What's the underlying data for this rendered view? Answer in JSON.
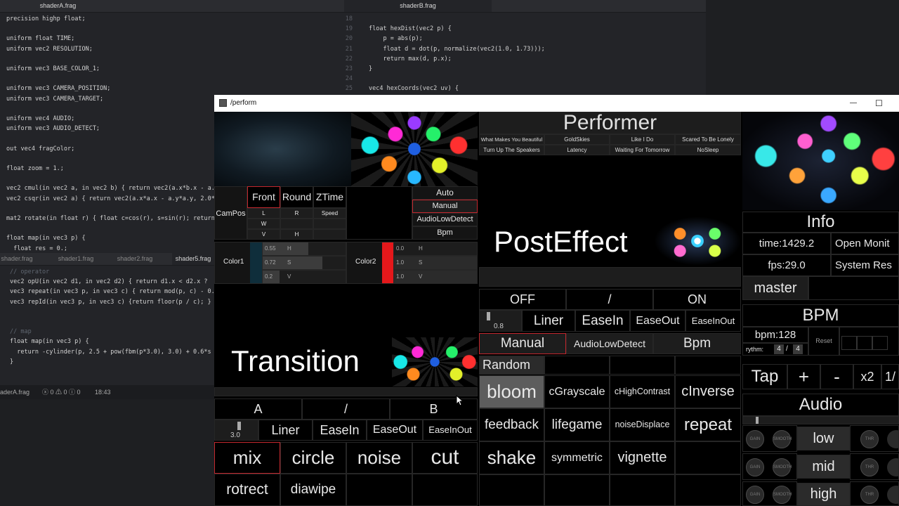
{
  "editor": {
    "tab_a": "shaderA.frag",
    "tab_b": "shaderB.frag",
    "bottom_tabs": [
      "shader.frag",
      "shader1.frag",
      "shader2.frag",
      "shader5.frag"
    ],
    "code_a": [
      "precision highp float;",
      "",
      "uniform float TIME;",
      "uniform vec2 RESOLUTION;",
      "",
      "uniform vec3 BASE_COLOR_1;",
      "",
      "uniform vec3 CAMERA_POSITION;",
      "uniform vec3 CAMERA_TARGET;",
      "",
      "uniform vec4 AUDIO;",
      "uniform vec3 AUDIO_DETECT;",
      "",
      "out vec4 fragColor;",
      "",
      "float zoom = 1.;",
      "",
      "vec2 cmul(in vec2 a, in vec2 b) { return vec2(a.x*b.x - a.",
      "vec2 csqr(in vec2 a) { return vec2(a.x*a.x - a.y*a.y, 2.0*",
      "",
      "mat2 rotate(in float r) { float c=cos(r), s=sin(r); return",
      "",
      "float map(in vec3 p) {",
      "  float res = 0.;"
    ],
    "code_b_numbers": [
      "18",
      "19",
      "20",
      "21",
      "22",
      "23",
      "24",
      "25"
    ],
    "code_b": [
      "",
      "float hexDist(vec2 p) {",
      "    p = abs(p);",
      "    float d = dot(p, normalize(vec2(1.0, 1.73)));",
      "    return max(d, p.x);",
      "}",
      "",
      "vec4 hexCoords(vec2 uv) {"
    ],
    "code_c": [
      "// operator",
      "vec2 opU(in vec2 d1, in vec2 d2) { return d1.x < d2.x ?",
      "vec3 repeat(in vec3 p, in vec3 c) { return mod(p, c) - 0.",
      "vec3 repId(in vec3 p, in vec3 c) {return floor(p / c); }",
      "",
      "",
      "// map",
      "float map(in vec3 p) {",
      "  return -cylinder(p, 2.5 + pow(fbm(p*3.0), 3.0) + 0.6*s",
      "}"
    ],
    "status_file": "aderA.frag",
    "status_problems": "ⓧ 0 ⚠ 0 ⓘ 0",
    "status_pos": "18:43"
  },
  "window": {
    "title": "/perform",
    "minimize": "—",
    "maximize": "☐"
  },
  "camera": {
    "campos": "CamPos",
    "tabs": [
      "Front",
      "Round",
      "ZTime"
    ],
    "rows": [
      [
        "L",
        "R",
        "Speed"
      ],
      [
        "W",
        "",
        ""
      ],
      [
        "V",
        "H",
        ""
      ]
    ],
    "modes": [
      "Auto",
      "Manual",
      "AudioLowDetect",
      "Bpm"
    ],
    "color1_label": "Color1",
    "color1_values": [
      "0.55",
      "0.72",
      "0.2"
    ],
    "color1_keys": [
      "H",
      "S",
      "V"
    ],
    "color2_label": "Color2",
    "color2_values": [
      "0.0",
      "1.0",
      "1.0"
    ],
    "color2_keys": [
      "H",
      "S",
      "V"
    ]
  },
  "transition": {
    "title": "Transition",
    "a": "A",
    "slash": "/",
    "b": "B",
    "value": "3.0",
    "easings": [
      "Liner",
      "EaseIn",
      "EaseOut",
      "EaseInOut"
    ],
    "effects": [
      "mix",
      "circle",
      "noise",
      "cut",
      "rotrect",
      "diawipe"
    ]
  },
  "performer": {
    "title": "Performer",
    "songs": [
      "What Makes You Beautiful",
      "GoldSkies",
      "Like I Do",
      "Scared To Be Lonely",
      "Turn Up The Speakers",
      "Latency",
      "Waiting For Tomorrow",
      "NoSleep"
    ]
  },
  "posteffect": {
    "title": "PostEffect",
    "off": "OFF",
    "slash": "/",
    "on": "ON",
    "value": "0.8",
    "easings": [
      "Liner",
      "EaseIn",
      "EaseOut",
      "EaseInOut"
    ],
    "modes": [
      "Manual",
      "AudioLowDetect",
      "Bpm"
    ],
    "random": "Random",
    "effects": [
      "bloom",
      "cGrayscale",
      "cHighContrast",
      "cInverse",
      "feedback",
      "lifegame",
      "noiseDisplace",
      "repeat",
      "shake",
      "symmetric",
      "vignette"
    ]
  },
  "info": {
    "title": "Info",
    "time": "time:1429.2",
    "fps": "fps:29.0",
    "open_monitor": "Open Monit",
    "system_res": "System Res",
    "master": "master"
  },
  "bpm": {
    "title": "BPM",
    "value": "bpm:128",
    "rhythm_label": "rythm:",
    "rhythm_a": "4",
    "rhythm_sep": "/",
    "rhythm_b": "4",
    "reset": "Reset",
    "tap": "Tap",
    "plus": "+",
    "minus": "-",
    "x2": "x2",
    "half": "1/"
  },
  "audio": {
    "title": "Audio",
    "bands": [
      "low",
      "mid",
      "high"
    ],
    "knob_gain": "GAIN",
    "knob_smooth": "SMOOTH",
    "knob_thr": "THR"
  },
  "colors": {
    "selected_border": "#c2272d",
    "color2_swatch": "#e4181b",
    "color1_swatch": "#0f2e3b"
  }
}
